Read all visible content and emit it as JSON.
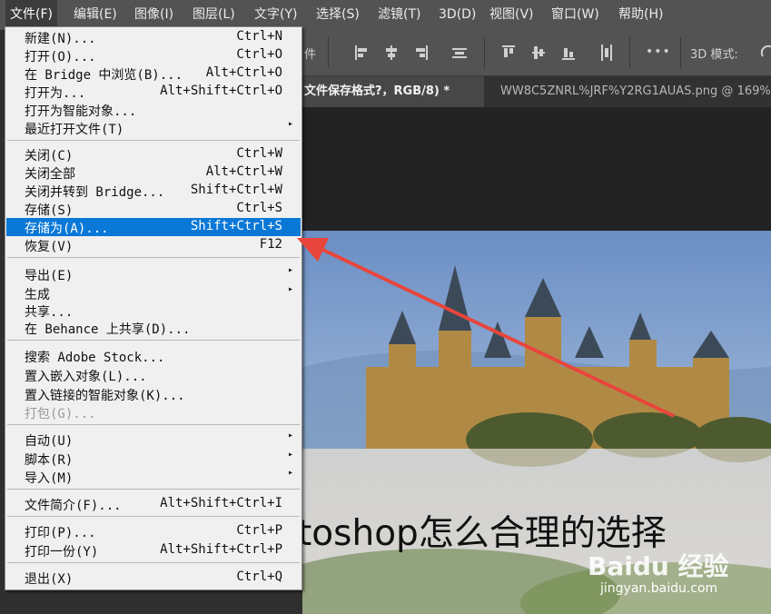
{
  "menubar": [
    {
      "label": "文件(F)"
    },
    {
      "label": "编辑(E)"
    },
    {
      "label": "图像(I)"
    },
    {
      "label": "图层(L)"
    },
    {
      "label": "文字(Y)"
    },
    {
      "label": "选择(S)"
    },
    {
      "label": "滤镜(T)"
    },
    {
      "label": "3D(D)"
    },
    {
      "label": "视图(V)"
    },
    {
      "label": "窗口(W)"
    },
    {
      "label": "帮助(H)"
    }
  ],
  "options_bar": {
    "partial_label": "件",
    "mode_label": "3D 模式:",
    "more_glyph": "•••"
  },
  "tabs": [
    {
      "label": "文件保存格式?，RGB/8) *"
    },
    {
      "label": "WW8C5ZNRL%JRF%Y2RG1AUAS.png @ 169%"
    }
  ],
  "canvas": {
    "caption": "toshop怎么合理的选择",
    "watermark_logo": "Baidu 经验",
    "watermark_url": "jingyan.baidu.com"
  },
  "file_menu": {
    "items": [
      {
        "label": "新建(N)...",
        "shortcut": "Ctrl+N"
      },
      {
        "label": "打开(O)...",
        "shortcut": "Ctrl+O"
      },
      {
        "label": "在 Bridge 中浏览(B)...",
        "shortcut": "Alt+Ctrl+O"
      },
      {
        "label": "打开为...",
        "shortcut": "Alt+Shift+Ctrl+O"
      },
      {
        "label": "打开为智能对象...",
        "shortcut": ""
      },
      {
        "label": "最近打开文件(T)",
        "shortcut": "",
        "submenu": "▸"
      },
      {
        "label": "关闭(C)",
        "shortcut": "Ctrl+W"
      },
      {
        "label": "关闭全部",
        "shortcut": "Alt+Ctrl+W"
      },
      {
        "label": "关闭并转到 Bridge...",
        "shortcut": "Shift+Ctrl+W"
      },
      {
        "label": "存储(S)",
        "shortcut": "Ctrl+S"
      },
      {
        "label": "存储为(A)...",
        "shortcut": "Shift+Ctrl+S"
      },
      {
        "label": "恢复(V)",
        "shortcut": "F12"
      },
      {
        "label": "导出(E)",
        "shortcut": "",
        "submenu": "▸"
      },
      {
        "label": "生成",
        "shortcut": "",
        "submenu": "▸"
      },
      {
        "label": "共享...",
        "shortcut": ""
      },
      {
        "label": "在 Behance 上共享(D)...",
        "shortcut": ""
      },
      {
        "label": "搜索 Adobe Stock...",
        "shortcut": ""
      },
      {
        "label": "置入嵌入对象(L)...",
        "shortcut": ""
      },
      {
        "label": "置入链接的智能对象(K)...",
        "shortcut": ""
      },
      {
        "label": "打包(G)...",
        "shortcut": ""
      },
      {
        "label": "自动(U)",
        "shortcut": "",
        "submenu": "▸"
      },
      {
        "label": "脚本(R)",
        "shortcut": "",
        "submenu": "▸"
      },
      {
        "label": "导入(M)",
        "shortcut": "",
        "submenu": "▸"
      },
      {
        "label": "文件简介(F)...",
        "shortcut": "Alt+Shift+Ctrl+I"
      },
      {
        "label": "打印(P)...",
        "shortcut": "Ctrl+P"
      },
      {
        "label": "打印一份(Y)",
        "shortcut": "Alt+Shift+Ctrl+P"
      },
      {
        "label": "退出(X)",
        "shortcut": "Ctrl+Q"
      }
    ]
  },
  "colors": {
    "highlight": "#0a78d7",
    "annotation_arrow": "#e8453c",
    "menu_bg": "#f0f0f0",
    "chrome": "#535353"
  }
}
